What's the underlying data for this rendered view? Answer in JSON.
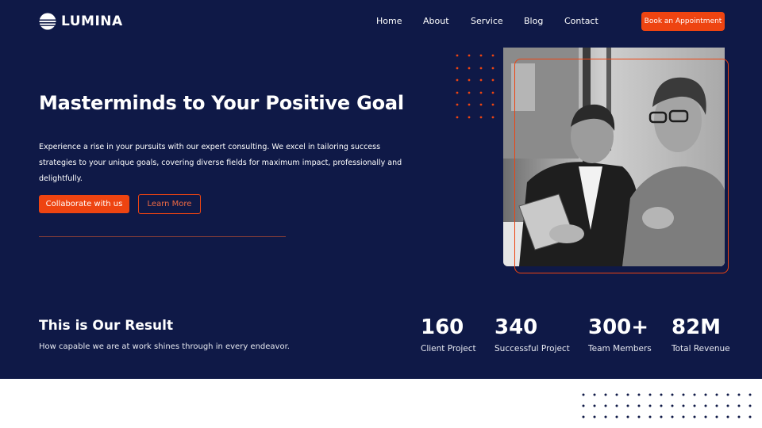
{
  "brand": {
    "name": "LUMINA",
    "logo_icon": "globe-icon"
  },
  "nav": {
    "items": [
      "Home",
      "About",
      "Service",
      "Blog",
      "Contact"
    ],
    "cta": "Book an Appointment"
  },
  "hero": {
    "headline": "Masterminds to Your Positive Goal",
    "description": "Experience a rise in your pursuits with our expert consulting. We excel in tailoring success strategies to your unique goals, covering diverse fields for maximum impact, professionally and delightfully.",
    "primary_button": "Collaborate with us",
    "secondary_button": "Learn More"
  },
  "results": {
    "title": "This is Our Result",
    "subtitle": "How capable we are at work shines through in every endeavor.",
    "stats": [
      {
        "value": "160",
        "label": "Client Project"
      },
      {
        "value": "340",
        "label": "Successful Project"
      },
      {
        "value": "300+",
        "label": "Team Members"
      },
      {
        "value": "82M",
        "label": "Total Revenue"
      }
    ]
  },
  "colors": {
    "background": "#0f1947",
    "accent": "#ee4411",
    "text": "#ffffff"
  }
}
